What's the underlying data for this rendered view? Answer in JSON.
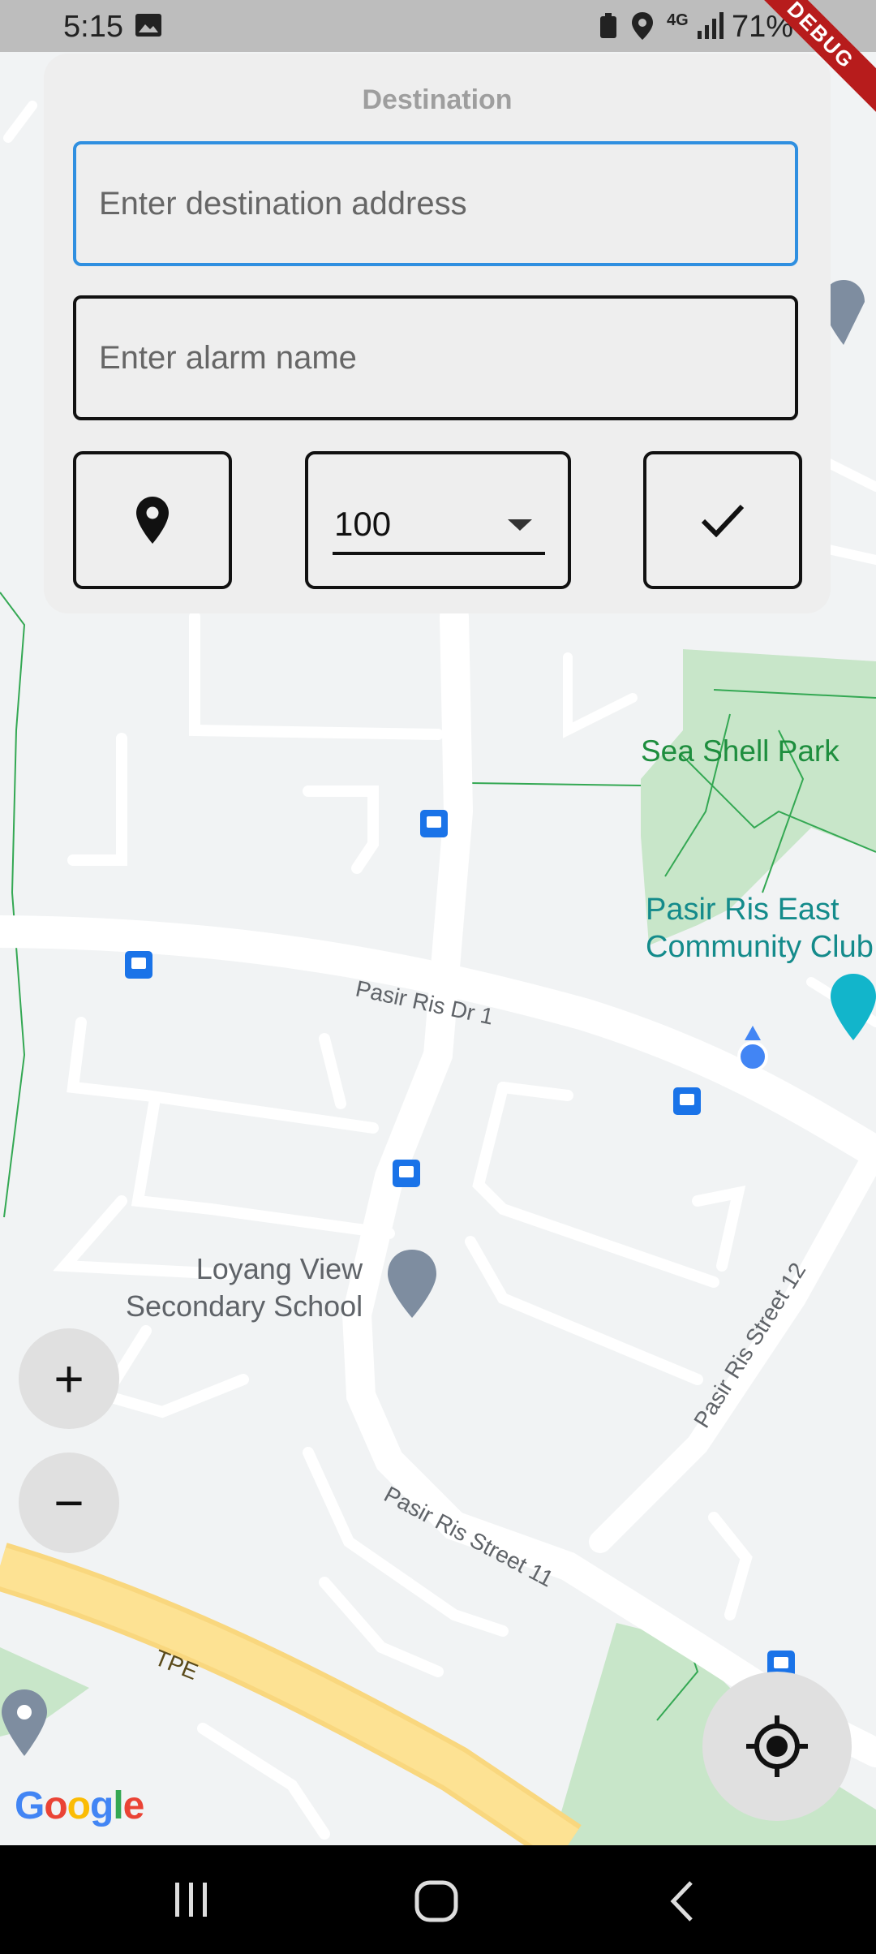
{
  "status_bar": {
    "time": "5:15",
    "battery_percent": "71%",
    "network": "4G",
    "debug_banner": "DEBUG"
  },
  "destination_card": {
    "title": "Destination",
    "address_placeholder": "Enter destination address",
    "alarm_name_placeholder": "Enter alarm name",
    "radius_value": "100",
    "icons": {
      "pick_location": "location-pin-icon",
      "confirm": "checkmark-icon",
      "dropdown": "dropdown-arrow-icon"
    }
  },
  "map": {
    "labels": {
      "park": "Sea Shell Park",
      "community_club": "Pasir Ris East\nCommunity Club",
      "school": "Loyang View\nSecondary School",
      "street_dr1": "Pasir Ris Dr 1",
      "street_12": "Pasir Ris Street 12",
      "street_11": "Pasir Ris Street 11",
      "highway": "TPE"
    },
    "attribution": "Google",
    "colors": {
      "background": "#f1f3f4",
      "road": "#ffffff",
      "park": "#c8e6c9",
      "highway": "#fde293",
      "bus_stop": "#1a73e8",
      "my_location": "#4285f4"
    }
  },
  "controls": {
    "zoom_in": "+",
    "zoom_out": "−",
    "my_location_icon": "gps-crosshair-icon"
  },
  "navigation_bar": {
    "recents_icon": "recents-icon",
    "home_icon": "home-icon",
    "back_icon": "back-icon"
  }
}
